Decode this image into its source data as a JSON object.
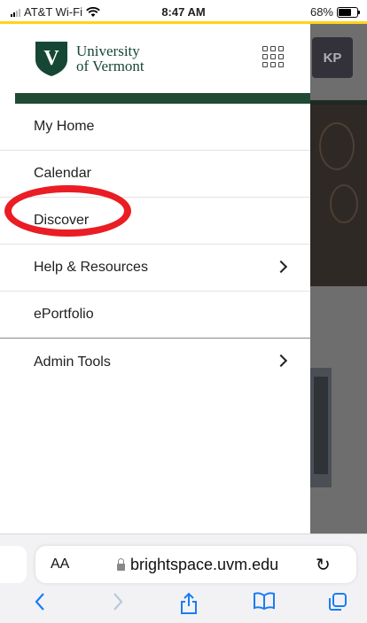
{
  "status_bar": {
    "carrier": "AT&T Wi-Fi",
    "time": "8:47 AM",
    "battery": "68%",
    "battery_level": 0.68
  },
  "background_page": {
    "avatar_initials": "KP"
  },
  "drawer": {
    "logo_line1": "University",
    "logo_line2": "of Vermont",
    "logo_letter": "V",
    "menu": [
      {
        "label": "My Home"
      },
      {
        "label": "Calendar"
      },
      {
        "label": "Discover"
      },
      {
        "label": "Help & Resources"
      },
      {
        "label": "ePortfolio"
      },
      {
        "label": "Admin Tools"
      }
    ]
  },
  "safari": {
    "text_size_label": "AA",
    "url": "brightspace.uvm.edu"
  },
  "colors": {
    "brand_green": "#154734",
    "accent_gold": "#ffd416",
    "highlight_red": "#ea1c24",
    "ios_blue": "#1a7cf5"
  }
}
